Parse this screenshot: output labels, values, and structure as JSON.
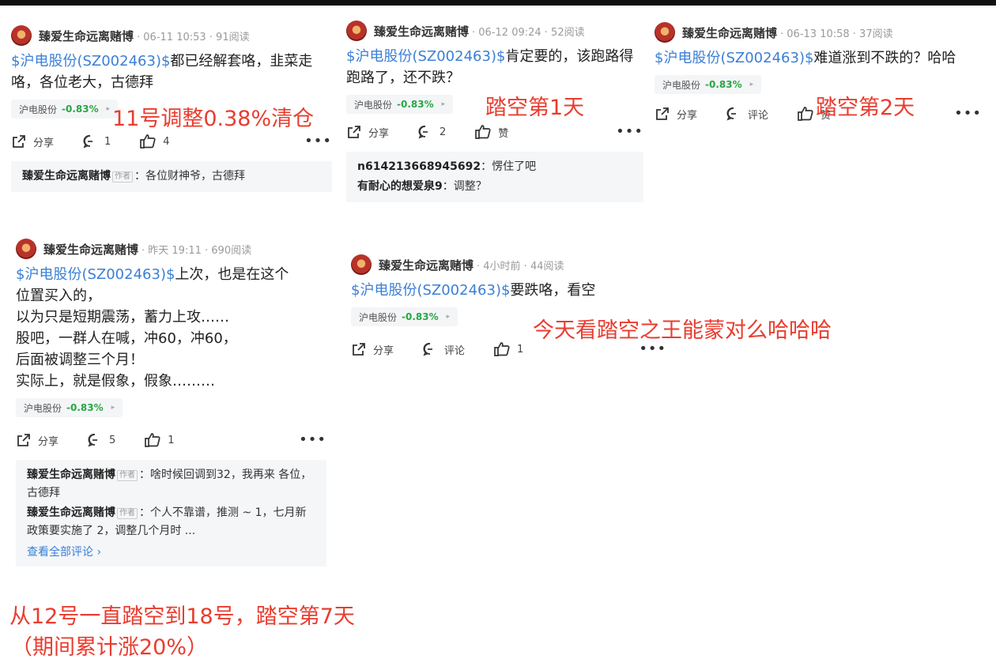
{
  "colors": {
    "stock_link": "#3a7fd6",
    "change_green": "#28a745",
    "annotation_red": "#e83d2f"
  },
  "icons": [
    "share-icon",
    "comment-icon",
    "like-icon",
    "more-icon",
    "chevron-right-icon"
  ],
  "posts": [
    {
      "user": "臻爱生命远离赌博",
      "meta": "· 06-11 10:53 · 91阅读",
      "stock_link": "$沪电股份(SZ002463)$",
      "text": "都已经解套咯，韭菜走咯，各位老大，古德拜",
      "tag_name": "沪电股份",
      "tag_change": "-0.83%",
      "share": "分享",
      "comment": "1",
      "like": "4",
      "comments": [
        {
          "user": "臻爱生命远离赌博",
          "badge": "作者",
          "text": "：各位财神爷，古德拜"
        }
      ]
    },
    {
      "user": "臻爱生命远离赌博",
      "meta": "· 06-12 09:24 · 52阅读",
      "stock_link": "$沪电股份(SZ002463)$",
      "text": "肯定要的，该跑路得跑路了，还不跌？",
      "tag_name": "沪电股份",
      "tag_change": "-0.83%",
      "share": "分享",
      "comment": "2",
      "like": "赞",
      "comments": [
        {
          "user": "n614213668945692",
          "text": "：愣住了吧"
        },
        {
          "user": "有耐心的想爱泉9",
          "text": "：调整？"
        }
      ]
    },
    {
      "user": "臻爱生命远离赌博",
      "meta": "· 06-13 10:58 · 37阅读",
      "stock_link": "$沪电股份(SZ002463)$",
      "text": "难道涨到不跌的？哈哈",
      "tag_name": "沪电股份",
      "tag_change": "-0.83%",
      "share": "分享",
      "comment": "评论",
      "like": "赞"
    },
    {
      "user": "臻爱生命远离赌博",
      "meta": "· 昨天 19:11 · 690阅读",
      "stock_link": "$沪电股份(SZ002463)$",
      "text_lines": [
        "上次，也是在这个",
        "位置买入的，",
        "以为只是短期震荡，蓄力上攻……",
        "股吧，一群人在喊，冲60，冲60，",
        "后面被调整三个月！",
        "实际上，就是假象，假象………"
      ],
      "tag_name": "沪电股份",
      "tag_change": "-0.83%",
      "share": "分享",
      "comment": "5",
      "like": "1",
      "comments": [
        {
          "user": "臻爱生命远离赌博",
          "badge": "作者",
          "text": "：啥时候回调到32，我再来 各位，古德拜"
        },
        {
          "user": "臻爱生命远离赌博",
          "badge": "作者",
          "text": "：个人不靠谱，推测 ~ 1，七月新政策要实施了 2，调整几个月时 ..."
        }
      ],
      "see_all": "查看全部评论"
    },
    {
      "user": "臻爱生命远离赌博",
      "meta": "· 4小时前 · 44阅读",
      "stock_link": "$沪电股份(SZ002463)$",
      "text": "要跌咯，看空",
      "tag_name": "沪电股份",
      "tag_change": "-0.83%",
      "share": "分享",
      "comment": "评论",
      "like": "1"
    }
  ],
  "annotations": {
    "a1": "11号调整0.38%清仓",
    "a2": "踏空第1天",
    "a3": "踏空第2天",
    "a4": "今天看踏空之王能蒙对么哈哈哈",
    "a5_line1": "从12号一直踏空到18号，踏空第7天",
    "a5_line2": "（期间累计涨20%）"
  }
}
